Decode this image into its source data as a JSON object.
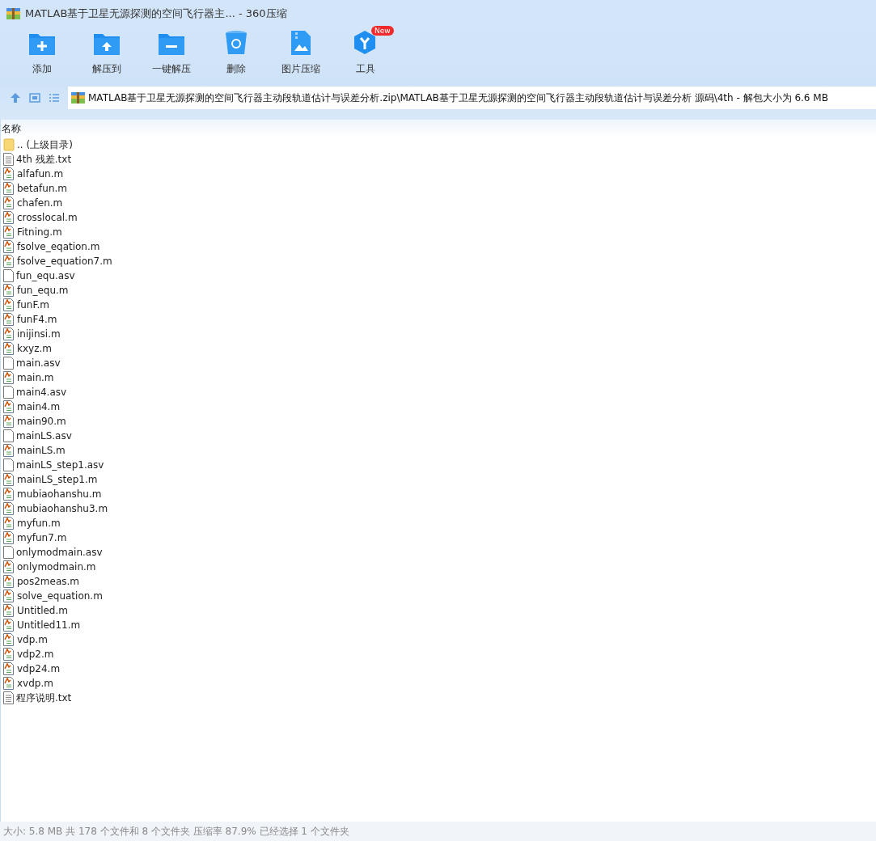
{
  "window": {
    "title": "MATLAB基于卫星无源探测的空间飞行器主... - 360压缩"
  },
  "toolbar": [
    {
      "label": "添加",
      "kind": "add"
    },
    {
      "label": "解压到",
      "kind": "extract"
    },
    {
      "label": "一键解压",
      "kind": "quick"
    },
    {
      "label": "删除",
      "kind": "delete"
    },
    {
      "label": "图片压缩",
      "kind": "image"
    },
    {
      "label": "工具",
      "kind": "tools",
      "badge": "New"
    }
  ],
  "address_bar": {
    "path": "MATLAB基于卫星无源探测的空间飞行器主动段轨道估计与误差分析.zip\\MATLAB基于卫星无源探测的空间飞行器主动段轨道估计与误差分析 源码\\4th - 解包大小为 6.6 MB"
  },
  "file_list": {
    "column": "名称",
    "rows": [
      {
        "name": ".. (上级目录)",
        "kind": "folder"
      },
      {
        "name": "4th 残差.txt",
        "kind": "text"
      },
      {
        "name": "alfafun.m",
        "kind": "matlab"
      },
      {
        "name": "betafun.m",
        "kind": "matlab"
      },
      {
        "name": "chafen.m",
        "kind": "matlab"
      },
      {
        "name": "crosslocal.m",
        "kind": "matlab"
      },
      {
        "name": "Fitning.m",
        "kind": "matlab"
      },
      {
        "name": "fsolve_eqation.m",
        "kind": "matlab"
      },
      {
        "name": "fsolve_equation7.m",
        "kind": "matlab"
      },
      {
        "name": "fun_equ.asv",
        "kind": "blank"
      },
      {
        "name": "fun_equ.m",
        "kind": "matlab"
      },
      {
        "name": "funF.m",
        "kind": "matlab"
      },
      {
        "name": "funF4.m",
        "kind": "matlab"
      },
      {
        "name": "inijinsi.m",
        "kind": "matlab"
      },
      {
        "name": "kxyz.m",
        "kind": "matlab"
      },
      {
        "name": "main.asv",
        "kind": "blank"
      },
      {
        "name": "main.m",
        "kind": "matlab"
      },
      {
        "name": "main4.asv",
        "kind": "blank"
      },
      {
        "name": "main4.m",
        "kind": "matlab"
      },
      {
        "name": "main90.m",
        "kind": "matlab"
      },
      {
        "name": "mainLS.asv",
        "kind": "blank"
      },
      {
        "name": "mainLS.m",
        "kind": "matlab"
      },
      {
        "name": "mainLS_step1.asv",
        "kind": "blank"
      },
      {
        "name": "mainLS_step1.m",
        "kind": "matlab"
      },
      {
        "name": "mubiaohanshu.m",
        "kind": "matlab"
      },
      {
        "name": "mubiaohanshu3.m",
        "kind": "matlab"
      },
      {
        "name": "myfun.m",
        "kind": "matlab"
      },
      {
        "name": "myfun7.m",
        "kind": "matlab"
      },
      {
        "name": "onlymodmain.asv",
        "kind": "blank"
      },
      {
        "name": "onlymodmain.m",
        "kind": "matlab"
      },
      {
        "name": "pos2meas.m",
        "kind": "matlab"
      },
      {
        "name": "solve_equation.m",
        "kind": "matlab"
      },
      {
        "name": "Untitled.m",
        "kind": "matlab"
      },
      {
        "name": "Untitled11.m",
        "kind": "matlab"
      },
      {
        "name": "vdp.m",
        "kind": "matlab"
      },
      {
        "name": "vdp2.m",
        "kind": "matlab"
      },
      {
        "name": "vdp24.m",
        "kind": "matlab"
      },
      {
        "name": "xvdp.m",
        "kind": "matlab"
      },
      {
        "name": "程序说明.txt",
        "kind": "text"
      }
    ]
  },
  "status_bar": "大小: 5.8 MB 共 178 个文件和 8 个文件夹 压缩率 87.9% 已经选择 1 个文件夹"
}
